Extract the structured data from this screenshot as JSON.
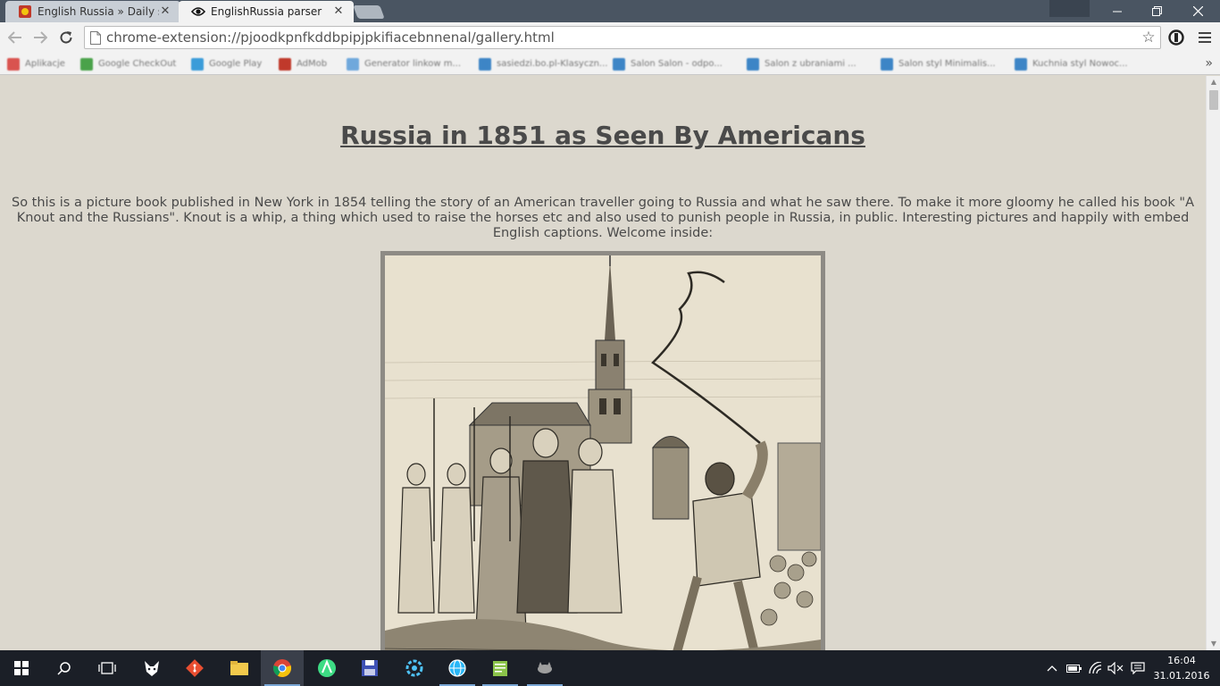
{
  "browser": {
    "tabs": [
      {
        "title": "English Russia » Daily sele",
        "active": false,
        "icon": "englishrussia-favicon"
      },
      {
        "title": "EnglishRussia parser",
        "active": true,
        "icon": "eye-icon"
      }
    ],
    "address_bar": {
      "url": "chrome-extension://pjoodkpnfkddbpipjpkifiacebnnenal/gallery.html"
    },
    "bookmarks": [
      {
        "label": "Aplikacje",
        "color": "#d9534f"
      },
      {
        "label": "Google CheckOut",
        "color": "#4aa24a"
      },
      {
        "label": "Google Play",
        "color": "#3b9cd9"
      },
      {
        "label": "AdMob",
        "color": "#c0392b"
      },
      {
        "label": "Generator linkow m...",
        "color": "#6fa8dc"
      },
      {
        "label": "sasiedzi.bo.pl-Klasyczn...",
        "color": "#3d85c6"
      },
      {
        "label": "Salon Salon - odpo...",
        "color": "#3d85c6"
      },
      {
        "label": "Salon z ubraniami ...",
        "color": "#3d85c6"
      },
      {
        "label": "Salon styl Minimalis...",
        "color": "#3d85c6"
      },
      {
        "label": "Kuchnia styl Nowoc...",
        "color": "#3d85c6"
      }
    ]
  },
  "page": {
    "title": "Russia in 1851 as Seen By Americans",
    "intro": "So this is a picture book published in New York in 1854 telling the story of an American traveller going to Russia and what he saw there. To make it more gloomy he called his book \"A Knout and the Russians\". Knout is a whip, a thing which used to raise the horses etc and also used to punish people in Russia, in public. Interesting pictures and happily with embed English captions. Welcome inside:"
  },
  "taskbar": {
    "apps": [
      "windows-start",
      "search",
      "task-view",
      "app-fox",
      "git-app",
      "file-explorer",
      "chrome",
      "android-studio",
      "save-app",
      "app-gear",
      "app-globe",
      "app-notepad",
      "app-cat"
    ],
    "clock": {
      "time": "16:04",
      "date": "31.01.2016"
    }
  },
  "colors": {
    "page_bg": "#dcd8ce",
    "text": "#4a4a4a",
    "tabstrip": "#4a5562",
    "taskbar": "#1b1f27"
  }
}
